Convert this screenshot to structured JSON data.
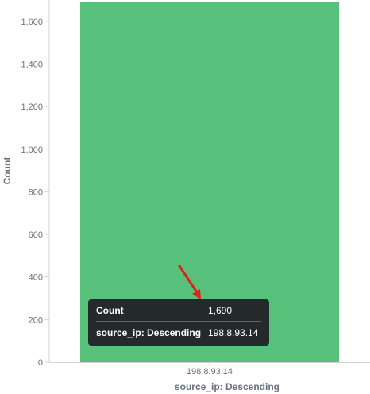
{
  "chart_data": {
    "type": "bar",
    "categories": [
      "198.8.93.14"
    ],
    "values": [
      1690
    ],
    "xlabel": "source_ip: Descending",
    "ylabel": "Count",
    "ylim": [
      0,
      1700
    ],
    "yticks": [
      0,
      200,
      400,
      600,
      800,
      1000,
      1200,
      1400,
      1600
    ],
    "ytick_labels": [
      "0",
      "200",
      "400",
      "600",
      "800",
      "1,000",
      "1,200",
      "1,400",
      "1,600"
    ],
    "grid": false,
    "bar_color": "#57c17b"
  },
  "tooltip": {
    "rows": [
      {
        "key": "Count",
        "value": "1,690"
      },
      {
        "key": "source_ip: Descending",
        "value": "198.8.93.14"
      }
    ]
  },
  "annotation": {
    "arrow_color": "#e0201a"
  }
}
